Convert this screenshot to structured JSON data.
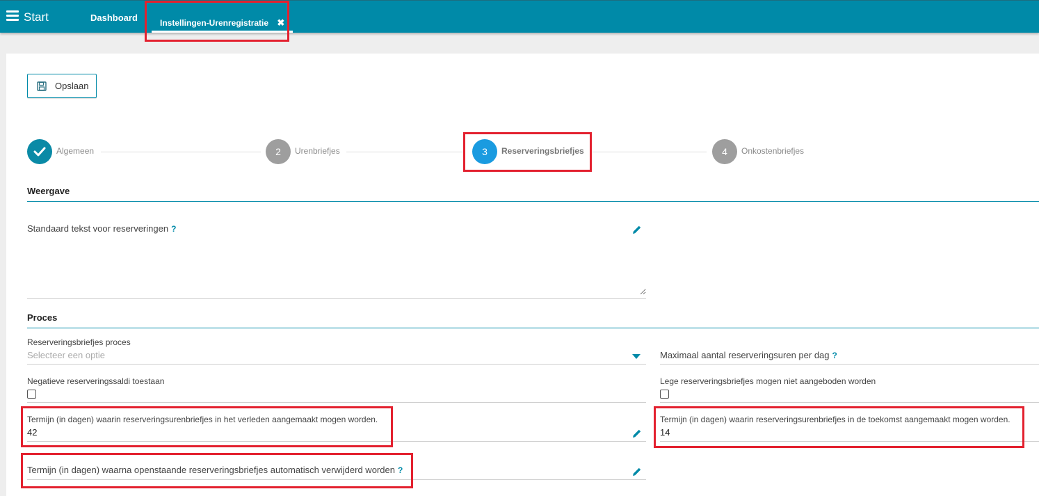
{
  "header": {
    "menu_label": "Start",
    "tabs": [
      {
        "label": "Dashboard"
      },
      {
        "label": "Instellingen-Urenregistratie",
        "closable": true,
        "active": true
      }
    ],
    "close_glyph": "✖",
    "background": "#008aa8"
  },
  "toolbar": {
    "save_label": "Opslaan",
    "save_icon": "floppy-disk-icon"
  },
  "stepper": {
    "steps": [
      {
        "number": "1",
        "label": "Algemeen",
        "state": "completed"
      },
      {
        "number": "2",
        "label": "Urenbriefjes",
        "state": "inactive"
      },
      {
        "number": "3",
        "label": "Reserveringsbriefjes",
        "state": "active"
      },
      {
        "number": "4",
        "label": "Onkostenbriefjes",
        "state": "inactive"
      }
    ],
    "colors": {
      "completed": "#0a8aa6",
      "active": "#1a9be0",
      "inactive": "#9e9e9e"
    }
  },
  "weergave": {
    "title": "Weergave",
    "standard_text": {
      "label": "Standaard tekst voor reserveringen",
      "help": "?",
      "value": ""
    }
  },
  "proces": {
    "title": "Proces",
    "process_select": {
      "label": "Reserveringsbriefjes proces",
      "placeholder": "Selecteer een optie"
    },
    "max_hours": {
      "label": "Maximaal aantal reserveringsuren per dag",
      "help": "?",
      "value": ""
    },
    "negative_balance": {
      "label": "Negatieve reserveringssaldi toestaan",
      "checked": false
    },
    "empty_not_offered": {
      "label": "Lege reserveringsbriefjes mogen niet aangeboden worden",
      "checked": false
    },
    "past_term": {
      "label": "Termijn (in dagen) waarin reserveringsurenbriefjes in het verleden aangemaakt mogen worden.",
      "value": "42"
    },
    "future_term": {
      "label": "Termijn (in dagen) waarin reserveringsurenbriefjes in de toekomst aangemaakt mogen worden.",
      "value": "14"
    },
    "auto_delete_term": {
      "label": "Termijn (in dagen) waarna openstaande reserveringsbriefjes automatisch verwijderd worden",
      "help": "?",
      "value": ""
    }
  },
  "accent_color": "#008aa8",
  "highlight_color": "#e3212f"
}
